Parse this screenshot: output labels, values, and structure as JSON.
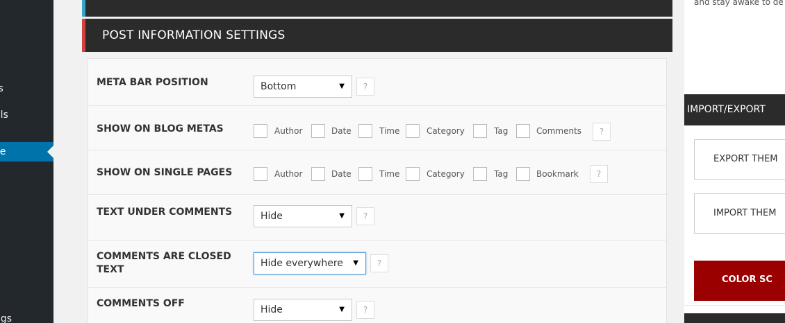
{
  "sidebar": {
    "items": [
      {
        "label": "ts"
      },
      {
        "label": "als"
      },
      {
        "label": "ce"
      },
      {
        "label": "ngs"
      }
    ]
  },
  "section": {
    "title": "POST INFORMATION SETTINGS"
  },
  "rows": {
    "meta_bar": {
      "label": "META BAR POSITION",
      "value": "Bottom",
      "help": "?"
    },
    "blog_metas": {
      "label": "SHOW ON BLOG METAS",
      "options": [
        "Author",
        "Date",
        "Time",
        "Category",
        "Tag",
        "Comments"
      ],
      "help": "?"
    },
    "single_pages": {
      "label": "SHOW ON SINGLE PAGES",
      "options": [
        "Author",
        "Date",
        "Time",
        "Category",
        "Tag",
        "Bookmark"
      ],
      "help": "?"
    },
    "text_under_comments": {
      "label": "TEXT UNDER COMMENTS",
      "value": "Hide",
      "help": "?"
    },
    "comments_closed": {
      "label_line1": "COMMENTS ARE CLOSED",
      "label_line2": "TEXT",
      "value": "Hide everywhere",
      "help": "?"
    },
    "comments_off": {
      "label": "COMMENTS OFF",
      "value": "Hide",
      "help": "?"
    }
  },
  "right": {
    "intro_text": "and stay awake to de",
    "import_export_title": "IMPORT/EXPORT",
    "export_button": "EXPORT THEM",
    "import_button": "IMPORT THEM",
    "color_button": "COLOR SC"
  },
  "colors": {
    "dark_header": "#2b2b2b",
    "accent_red": "#d2413f",
    "accent_blue": "#32a5c8",
    "wp_active": "#0073aa",
    "color_scheme_button": "#9b0000"
  }
}
